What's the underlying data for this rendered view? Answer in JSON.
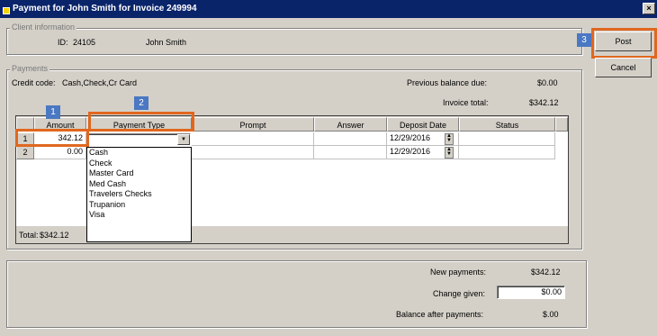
{
  "window": {
    "title": "Payment for John Smith for Invoice 249994",
    "close": "×"
  },
  "client": {
    "group_label": "Client information",
    "id_label": "ID:",
    "id_value": "24105",
    "name": "John Smith"
  },
  "buttons": {
    "post": "Post",
    "cancel": "Cancel"
  },
  "badges": {
    "b1": "1",
    "b2": "2",
    "b3": "3"
  },
  "payments": {
    "group_label": "Payments",
    "credit_code_label": "Credit code:",
    "credit_code_value": "Cash,Check,Cr Card",
    "prev_balance_label": "Previous balance due:",
    "prev_balance_value": "$0.00",
    "invoice_total_label": "Invoice total:",
    "invoice_total_value": "$342.12"
  },
  "grid": {
    "columns": [
      "Amount",
      "Payment Type",
      "Prompt",
      "Answer",
      "Deposit Date",
      "Status"
    ],
    "rows": [
      {
        "num": "1",
        "amount": "342.12",
        "payment_type": "",
        "prompt": "",
        "answer": "",
        "deposit_date": "12/29/2016",
        "status": ""
      },
      {
        "num": "2",
        "amount": "0.00",
        "payment_type": "",
        "prompt": "",
        "answer": "",
        "deposit_date": "12/29/2016",
        "status": ""
      }
    ],
    "total_label": "Total:",
    "total_value": "$342.12"
  },
  "dropdown": {
    "arrow": "▼",
    "options": [
      "Cash",
      "Check",
      "Master Card",
      "Med Cash",
      "Travelers Checks",
      "Trupanion",
      "Visa"
    ]
  },
  "summary": {
    "new_payments_label": "New payments:",
    "new_payments_value": "$342.12",
    "change_label": "Change given:",
    "change_value": "$0.00",
    "balance_label": "Balance after payments:",
    "balance_value": "$.00"
  },
  "colors": {
    "highlight": "#e0671f",
    "badge": "#4a78c2",
    "titlebar": "#0a246a"
  }
}
